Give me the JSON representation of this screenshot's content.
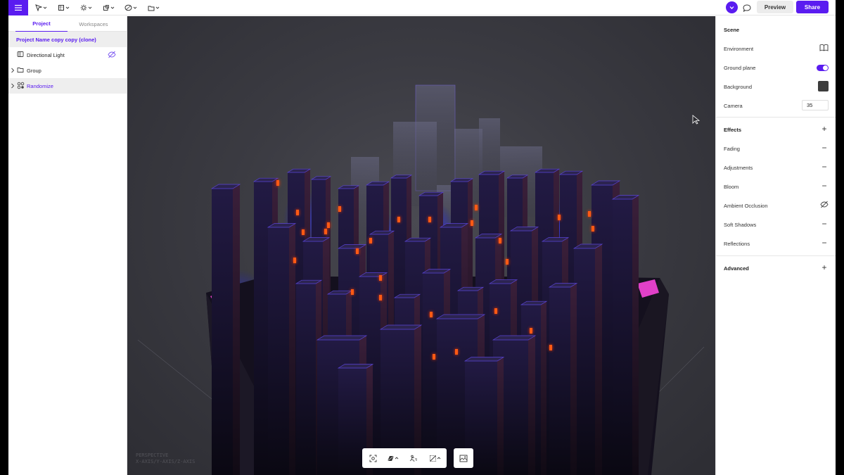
{
  "toolbar": {
    "icons": [
      "menu-icon",
      "select-tool-icon",
      "primitive-tool-icon",
      "light-tool-icon",
      "object-tool-icon",
      "material-tool-icon",
      "folder-icon"
    ],
    "avatar_initial": "V",
    "preview_label": "Preview",
    "share_label": "Share"
  },
  "left_panel": {
    "tabs": [
      "Project",
      "Workspaces"
    ],
    "active_tab": "Project",
    "project_name": "Project Name copy copy (clone)",
    "items": [
      {
        "label": "Directional Light",
        "icon": "directional-light-icon",
        "hidden": true
      },
      {
        "label": "Group",
        "icon": "folder-icon",
        "expandable": true
      },
      {
        "label": "Randomize",
        "icon": "randomize-icon",
        "expandable": true,
        "selected": true
      }
    ]
  },
  "viewport": {
    "camera_overlay": [
      "PERSPECTIVE",
      "X-AXIS/Y-AXIS/Z-AXIS"
    ],
    "bottom_tools": [
      "focus-icon",
      "view-mode-icon",
      "animation-icon",
      "render-icon",
      "image-icon"
    ]
  },
  "right_panel": {
    "scene_heading": "Scene",
    "environment_label": "Environment",
    "ground_plane_label": "Ground plane",
    "ground_plane_on": true,
    "background_label": "Background",
    "background_color": "#3c3c3c",
    "camera_label": "Camera",
    "camera_value": "35",
    "effects_heading": "Effects",
    "effects": [
      {
        "label": "Fading",
        "state": "minus"
      },
      {
        "label": "Adjustments",
        "state": "minus"
      },
      {
        "label": "Bloom",
        "state": "minus"
      },
      {
        "label": "Ambient Occlusion",
        "state": "hidden"
      },
      {
        "label": "Soft Shadows",
        "state": "minus"
      },
      {
        "label": "Reflections",
        "state": "minus"
      }
    ],
    "advanced_heading": "Advanced"
  },
  "colors": {
    "accent": "#5a1cf0",
    "viewport_bg": "#3b3b42",
    "building_dark": "#1a1530",
    "glow_blue": "#2a2aff",
    "glow_pink": "#ff40d0",
    "window_orange": "#ff5a14"
  }
}
